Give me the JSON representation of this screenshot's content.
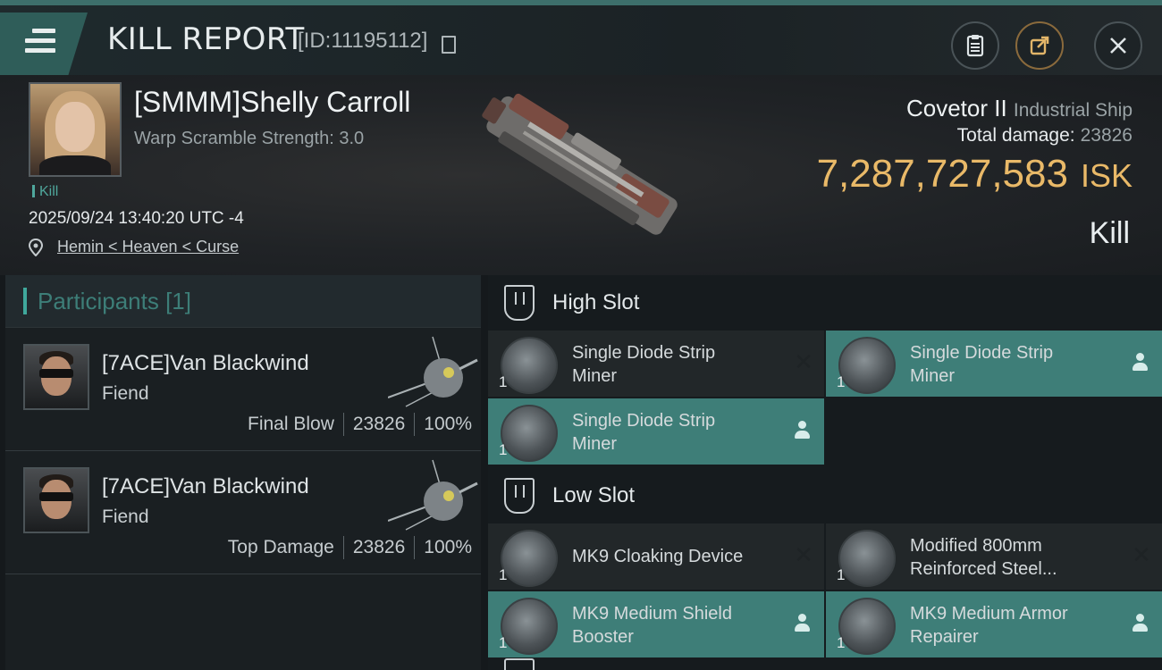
{
  "header": {
    "title": "KILL REPORT",
    "report_id": "[ID:11195112]"
  },
  "victim": {
    "name": "[SMMM]Shelly Carroll",
    "warp_scramble": "Warp Scramble Strength: 3.0",
    "tag": "Kill",
    "datetime": "2025/09/24 13:40:20 UTC -4",
    "location": "Hemin < Heaven < Curse",
    "ship_name": "Covetor II",
    "ship_class": "Industrial Ship",
    "total_damage_label": "Total damage:",
    "total_damage": "23826",
    "isk_value": "7,287,727,583",
    "isk_unit": "ISK",
    "result": "Kill"
  },
  "participants": {
    "heading": "Participants [1]",
    "rows": [
      {
        "name": "[7ACE]Van Blackwind",
        "ship": "Fiend",
        "role": "Final Blow",
        "damage": "23826",
        "percent": "100%"
      },
      {
        "name": "[7ACE]Van Blackwind",
        "ship": "Fiend",
        "role": "Top Damage",
        "damage": "23826",
        "percent": "100%"
      }
    ]
  },
  "slots": {
    "high": {
      "label": "High Slot",
      "modules": [
        {
          "line1": "Single Diode Strip",
          "line2": "Miner",
          "qty": "1",
          "state": "destroyed"
        },
        {
          "line1": "Single Diode Strip",
          "line2": "Miner",
          "qty": "1",
          "state": "dropped"
        },
        {
          "line1": "Single Diode Strip",
          "line2": "Miner",
          "qty": "1",
          "state": "dropped"
        }
      ]
    },
    "low": {
      "label": "Low Slot",
      "modules": [
        {
          "line1": "MK9 Cloaking Device",
          "line2": "",
          "qty": "1",
          "state": "destroyed"
        },
        {
          "line1": "Modified 800mm",
          "line2": "Reinforced Steel...",
          "qty": "1",
          "state": "destroyed"
        },
        {
          "line1": "MK9 Medium Shield",
          "line2": "Booster",
          "qty": "1",
          "state": "dropped"
        },
        {
          "line1": "MK9 Medium Armor",
          "line2": "Repairer",
          "qty": "1",
          "state": "dropped"
        }
      ]
    }
  },
  "icons": {
    "menu": "hamburger-icon",
    "clipboard": "clipboard-icon",
    "share": "share-icon",
    "close": "close-icon"
  },
  "colors": {
    "accent": "#3e7e78",
    "isk": "#e9b968"
  }
}
